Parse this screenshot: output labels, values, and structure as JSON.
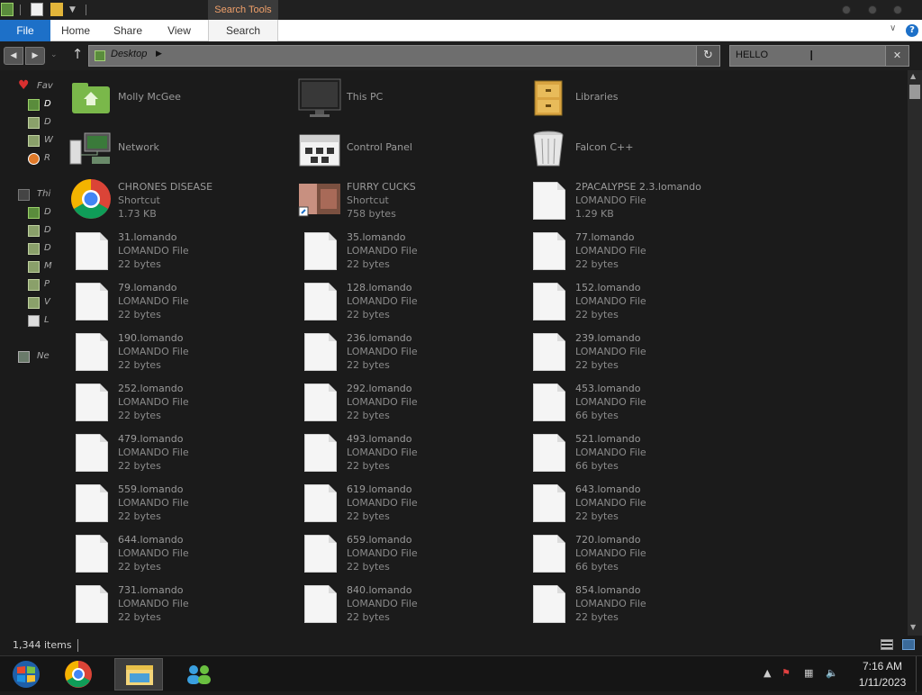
{
  "window": {
    "contextual_tab_label": "Search Tools"
  },
  "ribbon": {
    "tabs": [
      "File",
      "Home",
      "Share",
      "View",
      "Search"
    ]
  },
  "address": {
    "location": "Desktop"
  },
  "search": {
    "query": "HELLO"
  },
  "nav_pane": {
    "favorites_label": "Fav",
    "this_pc_label": "Thi",
    "network_label": "Ne",
    "truncated_letters": [
      "D",
      "D",
      "W",
      "R",
      "D",
      "D",
      "D",
      "M",
      "P",
      "V",
      "L"
    ]
  },
  "items": [
    {
      "name": "Molly McGee",
      "type": "",
      "size": "",
      "icon": "user-folder-icon"
    },
    {
      "name": "This PC",
      "type": "",
      "size": "",
      "icon": "this-pc-icon"
    },
    {
      "name": "Libraries",
      "type": "",
      "size": "",
      "icon": "libraries-icon"
    },
    {
      "name": "Network",
      "type": "",
      "size": "",
      "icon": "network-icon"
    },
    {
      "name": "Control Panel",
      "type": "",
      "size": "",
      "icon": "control-panel-icon"
    },
    {
      "name": "Falcon C++",
      "type": "",
      "size": "",
      "icon": "recycle-bin-icon"
    },
    {
      "name": "CHRONES DISEASE",
      "type": "Shortcut",
      "size": "1.73 KB",
      "icon": "chrome-icon"
    },
    {
      "name": "FURRY CUCKS",
      "type": "Shortcut",
      "size": "758 bytes",
      "icon": "photo-shortcut-icon"
    },
    {
      "name": "2PACALYPSE 2.3.lomando",
      "type": "LOMANDO File",
      "size": "1.29 KB",
      "icon": "file-icon"
    },
    {
      "name": "31.lomando",
      "type": "LOMANDO File",
      "size": "22 bytes",
      "icon": "file-icon"
    },
    {
      "name": "35.lomando",
      "type": "LOMANDO File",
      "size": "22 bytes",
      "icon": "file-icon"
    },
    {
      "name": "77.lomando",
      "type": "LOMANDO File",
      "size": "22 bytes",
      "icon": "file-icon"
    },
    {
      "name": "79.lomando",
      "type": "LOMANDO File",
      "size": "22 bytes",
      "icon": "file-icon"
    },
    {
      "name": "128.lomando",
      "type": "LOMANDO File",
      "size": "22 bytes",
      "icon": "file-icon"
    },
    {
      "name": "152.lomando",
      "type": "LOMANDO File",
      "size": "22 bytes",
      "icon": "file-icon"
    },
    {
      "name": "190.lomando",
      "type": "LOMANDO File",
      "size": "22 bytes",
      "icon": "file-icon"
    },
    {
      "name": "236.lomando",
      "type": "LOMANDO File",
      "size": "22 bytes",
      "icon": "file-icon"
    },
    {
      "name": "239.lomando",
      "type": "LOMANDO File",
      "size": "22 bytes",
      "icon": "file-icon"
    },
    {
      "name": "252.lomando",
      "type": "LOMANDO File",
      "size": "22 bytes",
      "icon": "file-icon"
    },
    {
      "name": "292.lomando",
      "type": "LOMANDO File",
      "size": "22 bytes",
      "icon": "file-icon"
    },
    {
      "name": "453.lomando",
      "type": "LOMANDO File",
      "size": "66 bytes",
      "icon": "file-icon"
    },
    {
      "name": "479.lomando",
      "type": "LOMANDO File",
      "size": "22 bytes",
      "icon": "file-icon"
    },
    {
      "name": "493.lomando",
      "type": "LOMANDO File",
      "size": "22 bytes",
      "icon": "file-icon"
    },
    {
      "name": "521.lomando",
      "type": "LOMANDO File",
      "size": "66 bytes",
      "icon": "file-icon"
    },
    {
      "name": "559.lomando",
      "type": "LOMANDO File",
      "size": "22 bytes",
      "icon": "file-icon"
    },
    {
      "name": "619.lomando",
      "type": "LOMANDO File",
      "size": "22 bytes",
      "icon": "file-icon"
    },
    {
      "name": "643.lomando",
      "type": "LOMANDO File",
      "size": "22 bytes",
      "icon": "file-icon"
    },
    {
      "name": "644.lomando",
      "type": "LOMANDO File",
      "size": "22 bytes",
      "icon": "file-icon"
    },
    {
      "name": "659.lomando",
      "type": "LOMANDO File",
      "size": "22 bytes",
      "icon": "file-icon"
    },
    {
      "name": "720.lomando",
      "type": "LOMANDO File",
      "size": "66 bytes",
      "icon": "file-icon"
    },
    {
      "name": "731.lomando",
      "type": "LOMANDO File",
      "size": "22 bytes",
      "icon": "file-icon"
    },
    {
      "name": "840.lomando",
      "type": "LOMANDO File",
      "size": "22 bytes",
      "icon": "file-icon"
    },
    {
      "name": "854.lomando",
      "type": "LOMANDO File",
      "size": "22 bytes",
      "icon": "file-icon"
    }
  ],
  "status": {
    "item_count": "1,344 items"
  },
  "taskbar": {
    "time": "7:16 AM",
    "date": "1/11/2023"
  },
  "colors": {
    "accent": "#1d70c8",
    "contextual_tab": "#f0a06a",
    "background": "#1b1b1b"
  }
}
